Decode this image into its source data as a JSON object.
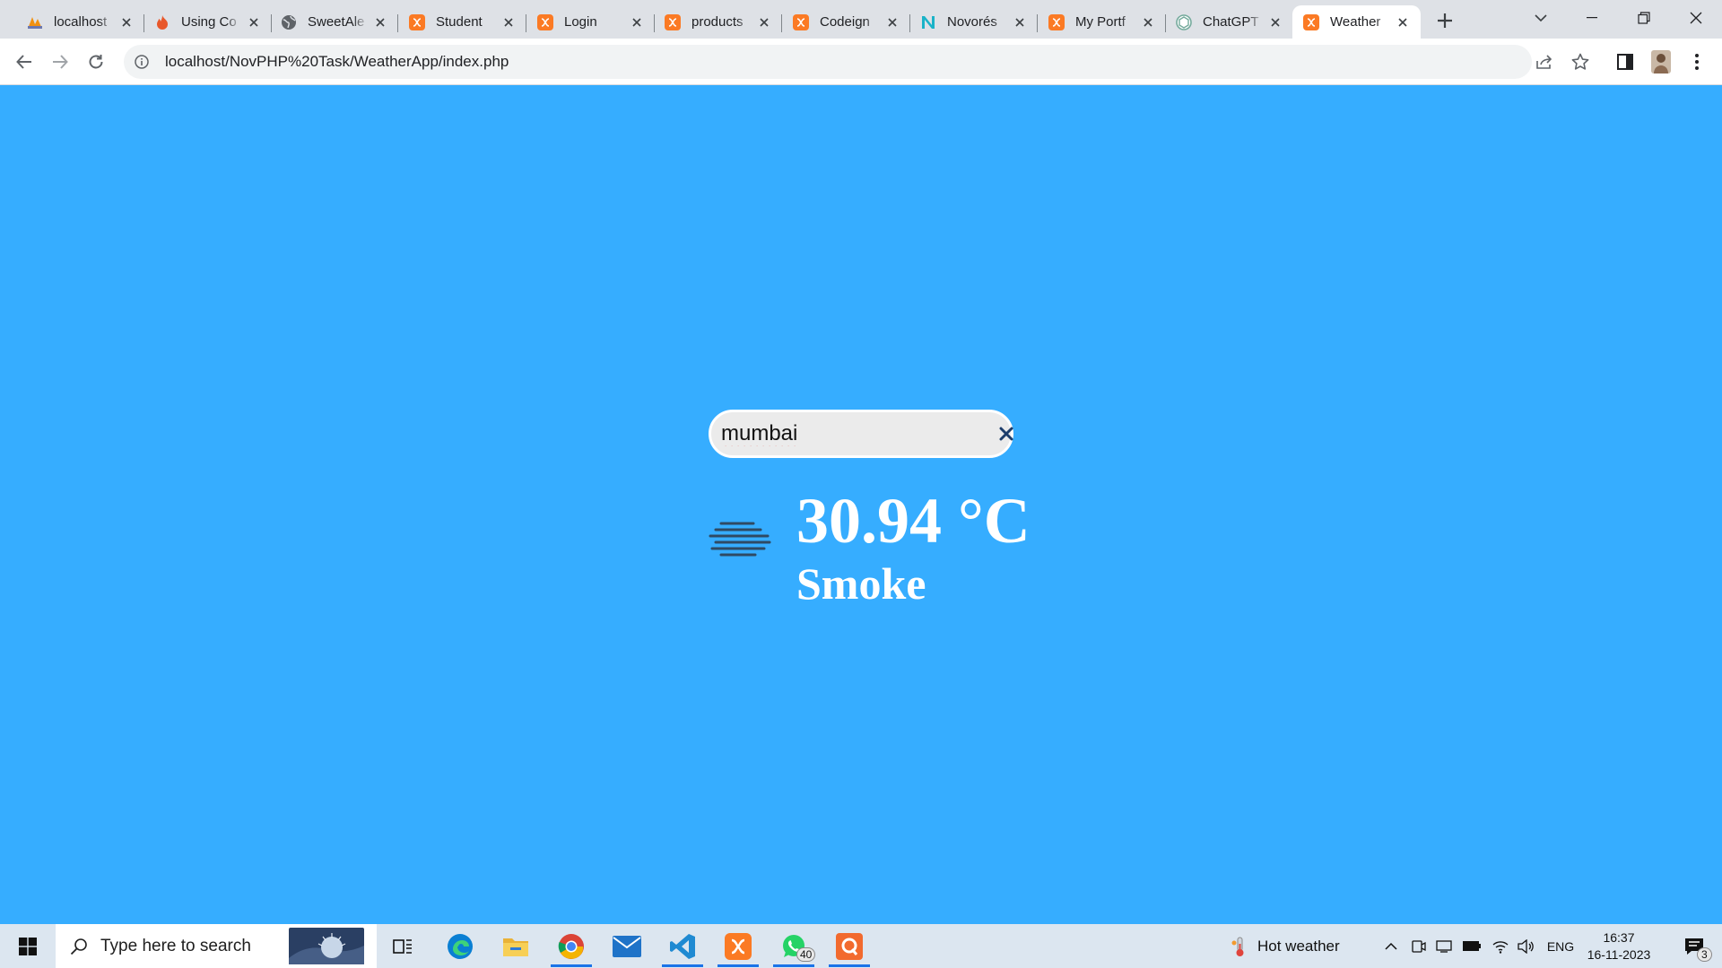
{
  "browser": {
    "tabs": [
      {
        "title": "localhost",
        "icon": "phpmyadmin-icon",
        "active": false
      },
      {
        "title": "Using Co",
        "icon": "fire-icon",
        "active": false
      },
      {
        "title": "SweetAle",
        "icon": "globe-icon",
        "active": false
      },
      {
        "title": "Student",
        "icon": "xampp-icon",
        "active": false
      },
      {
        "title": "Login",
        "icon": "xampp-icon",
        "active": false
      },
      {
        "title": "products",
        "icon": "xampp-icon",
        "active": false
      },
      {
        "title": "Codeign",
        "icon": "xampp-icon",
        "active": false
      },
      {
        "title": "Novorés",
        "icon": "novores-icon",
        "active": false
      },
      {
        "title": "My Portf",
        "icon": "xampp-icon",
        "active": false
      },
      {
        "title": "ChatGPT",
        "icon": "chatgpt-icon",
        "active": false
      },
      {
        "title": "Weather",
        "icon": "xampp-icon",
        "active": true
      }
    ],
    "url": "localhost/NovPHP%20Task/WeatherApp/index.php"
  },
  "page": {
    "background_color": "#36adff",
    "search": {
      "value": "mumbai",
      "clear_icon": "close-icon"
    },
    "weather": {
      "temperature": "30.94 °C",
      "description": "Smoke",
      "icon": "smoke-haze-icon"
    }
  },
  "taskbar": {
    "search_placeholder": "Type here to search",
    "weather_text": "Hot weather",
    "language": "ENG",
    "time": "16:37",
    "date": "16-11-2023",
    "whatsapp_badge": "40",
    "notification_badge": "3",
    "apps": [
      "task-view-icon",
      "edge-icon",
      "file-explorer-icon",
      "chrome-icon",
      "mail-icon",
      "vscode-icon",
      "xampp-icon",
      "whatsapp-icon",
      "qlik-icon"
    ]
  }
}
